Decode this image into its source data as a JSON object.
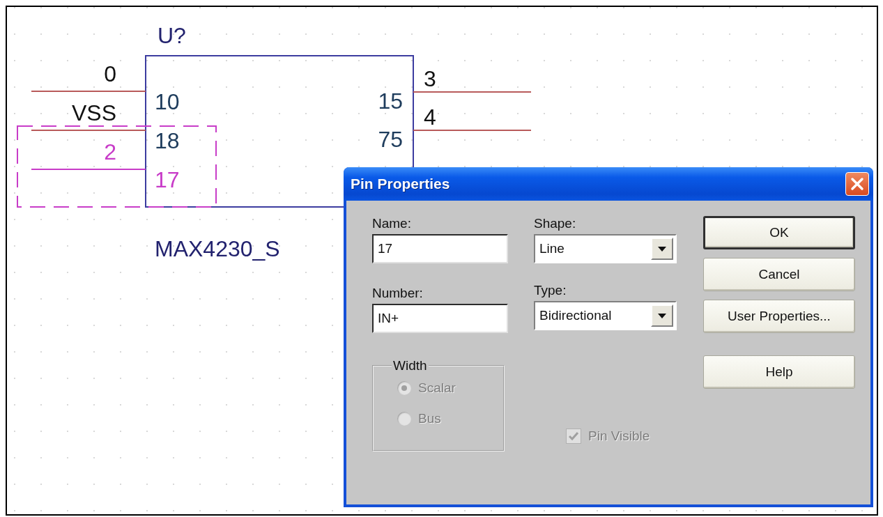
{
  "schematic": {
    "reference": "U?",
    "part_name": "MAX4230_S",
    "left_pins": [
      {
        "net": "0",
        "number": "10",
        "selected": false
      },
      {
        "net": "VSS",
        "number": "18",
        "selected": false
      },
      {
        "net": "2",
        "number": "17",
        "selected": true
      }
    ],
    "right_pins": [
      {
        "net": "3",
        "number": "15",
        "selected": false
      },
      {
        "net": "4",
        "number": "75",
        "selected": false
      }
    ]
  },
  "dialog": {
    "title": "Pin Properties",
    "fields": [
      {
        "label": "Name:",
        "value": "17"
      },
      {
        "label": "Number:",
        "value": "IN+"
      }
    ],
    "dropdowns": [
      {
        "label": "Shape:",
        "value": "Line"
      },
      {
        "label": "Type:",
        "value": "Bidirectional"
      }
    ],
    "width_group": {
      "label": "Width",
      "disabled": true,
      "options": [
        {
          "label": "Scalar",
          "selected": true
        },
        {
          "label": "Bus",
          "selected": false
        }
      ]
    },
    "pin_visible": {
      "label": "Pin Visible",
      "checked": true,
      "disabled": true
    },
    "buttons": [
      {
        "label": "OK",
        "default": true
      },
      {
        "label": "Cancel",
        "default": false
      },
      {
        "label": "User Properties...",
        "default": false
      },
      {
        "label": "Help",
        "default": false
      }
    ]
  }
}
